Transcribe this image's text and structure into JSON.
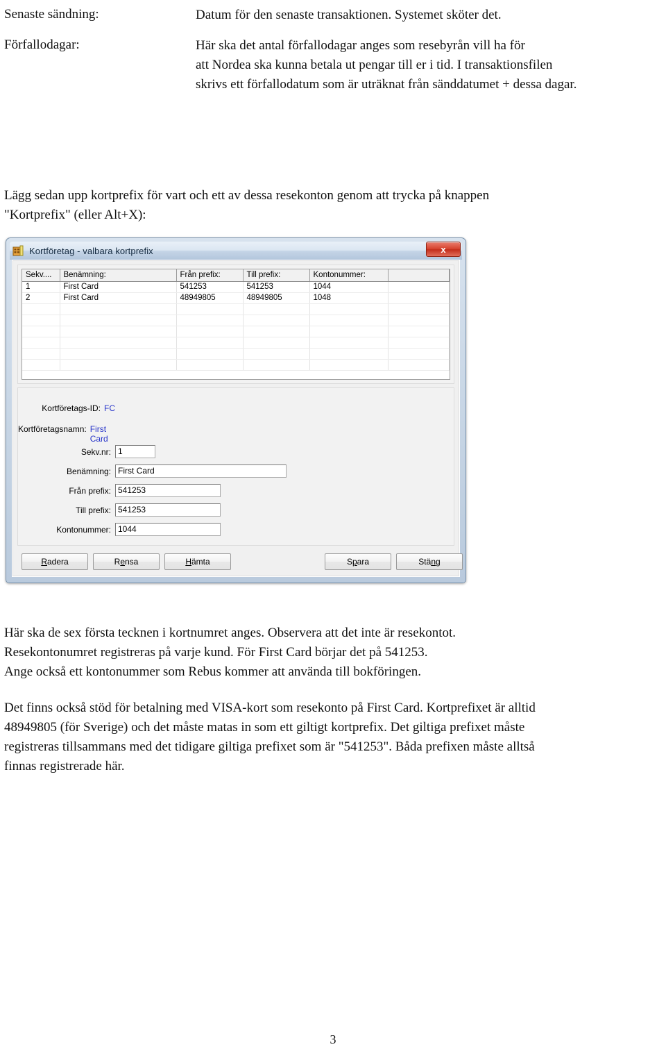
{
  "definitions": [
    {
      "term": "Senaste sändning:",
      "lines": [
        "Datum för den senaste transaktionen. Systemet sköter det."
      ]
    },
    {
      "term": "Förfallodagar:",
      "lines": [
        "Här ska det antal förfallodagar anges som resebyrån vill ha för",
        "att Nordea ska kunna betala ut pengar till er i tid. I transaktionsfilen",
        "skrivs ett förfallodatum som är uträknat från sänddatumet + dessa dagar."
      ]
    }
  ],
  "intro_paragraph": {
    "lines": [
      "Lägg sedan upp kortprefix för vart och ett av dessa resekonton genom att trycka på knappen",
      "\"Kortprefix\" (eller Alt+X):"
    ]
  },
  "dialog": {
    "title": "Kortföretag - valbara kortprefix",
    "icon": "application-icon",
    "close_label": "x",
    "grid": {
      "columns": [
        "Sekv....",
        "Benämning:",
        "Från prefix:",
        "Till prefix:",
        "Kontonummer:",
        ""
      ],
      "rows": [
        [
          "1",
          "First Card",
          "541253",
          "541253",
          "1044",
          ""
        ],
        [
          "2",
          "First Card",
          "48949805",
          "48949805",
          "1048",
          ""
        ]
      ],
      "empty_row_count": 6
    },
    "readonly_fields": [
      {
        "label": "Kortföretags-ID:",
        "value": "FC"
      },
      {
        "label": "Kortföretagsnamn:",
        "value": "First Card"
      }
    ],
    "fields": [
      {
        "label": "Sekv.nr:",
        "value": "1"
      },
      {
        "label": "Benämning:",
        "value": "First Card"
      },
      {
        "label": "Från prefix:",
        "value": "541253"
      },
      {
        "label": "Till prefix:",
        "value": "541253"
      },
      {
        "label": "Kontonummer:",
        "value": "1044"
      }
    ],
    "buttons": [
      {
        "label": "Radera",
        "accel_before": "",
        "accel": "R",
        "accel_after": "adera"
      },
      {
        "label": "Rensa",
        "accel_before": "R",
        "accel": "e",
        "accel_after": "nsa"
      },
      {
        "label": "Hämta",
        "accel_before": "",
        "accel": "H",
        "accel_after": "ämta"
      },
      {
        "label": "Spara",
        "accel_before": "S",
        "accel": "p",
        "accel_after": "ara"
      },
      {
        "label": "Stäng",
        "accel_before": "Stä",
        "accel": "n",
        "accel_after": "g"
      }
    ],
    "colors": {
      "title_bar": "#dbe6f2",
      "frame": "#b9cadd",
      "close_button": "#d6422e",
      "readonly_value": "#2734c9"
    }
  },
  "after_paragraph": {
    "lines": [
      "Här ska de sex första tecknen i kortnumret anges. Observera att det inte är resekontot.",
      "Resekontonumret registreras på varje kund. För First Card börjar det på 541253.",
      "Ange också ett kontonummer som Rebus kommer att använda till bokföringen."
    ]
  },
  "final_paragraph": {
    "lines": [
      "Det finns också stöd för betalning med VISA-kort som resekonto på First Card. Kortprefixet är alltid",
      "48949805 (för Sverige) och det måste matas in som ett giltigt kortprefix. Det giltiga prefixet måste",
      "registreras tillsammans med det tidigare giltiga prefixet som är \"541253\". Båda prefixen måste alltså",
      "finnas registrerade här."
    ]
  },
  "page_number": "3"
}
